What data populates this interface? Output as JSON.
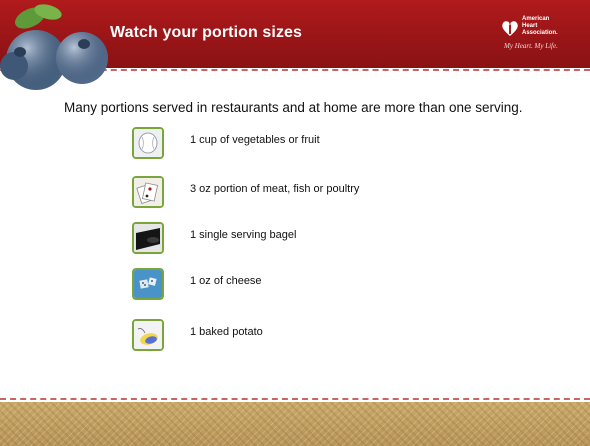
{
  "header": {
    "title": "Watch your portion sizes"
  },
  "logo": {
    "line1": "American",
    "line2": "Heart",
    "line3": "Association.",
    "tagline": "My Heart. My Life."
  },
  "intro": "Many portions served in restaurants and at home are more than one serving.",
  "items": [
    {
      "label": "1 cup of vegetables or fruit",
      "icon": "baseball-icon"
    },
    {
      "label": "3 oz portion of meat, fish or poultry",
      "icon": "playing-cards-icon"
    },
    {
      "label": "1 single serving bagel",
      "icon": "hockey-puck-icon"
    },
    {
      "label": "1 oz of cheese",
      "icon": "dice-icon"
    },
    {
      "label": "1 baked potato",
      "icon": "computer-mouse-icon"
    }
  ],
  "colors": {
    "header_red": "#9a1517",
    "thumb_border": "#7aa53b"
  }
}
